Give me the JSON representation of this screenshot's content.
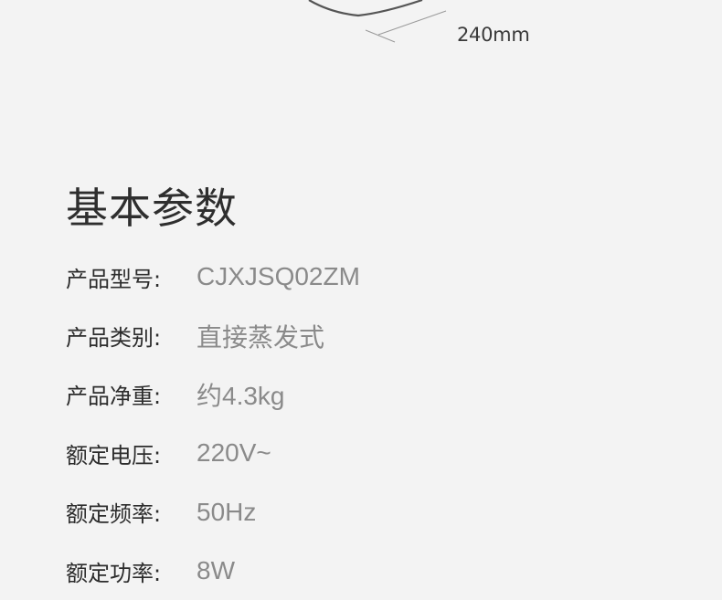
{
  "dimension": {
    "width_label": "240mm"
  },
  "section": {
    "title": "基本参数"
  },
  "specs": [
    {
      "label": "产品型号:",
      "value": "CJXJSQ02ZM"
    },
    {
      "label": "产品类别:",
      "value": "直接蒸发式"
    },
    {
      "label": "产品净重:",
      "value": "约4.3kg"
    },
    {
      "label": "额定电压:",
      "value": "220V~"
    },
    {
      "label": "额定频率:",
      "value": "50Hz"
    },
    {
      "label": "额定功率:",
      "value": "8W"
    }
  ]
}
